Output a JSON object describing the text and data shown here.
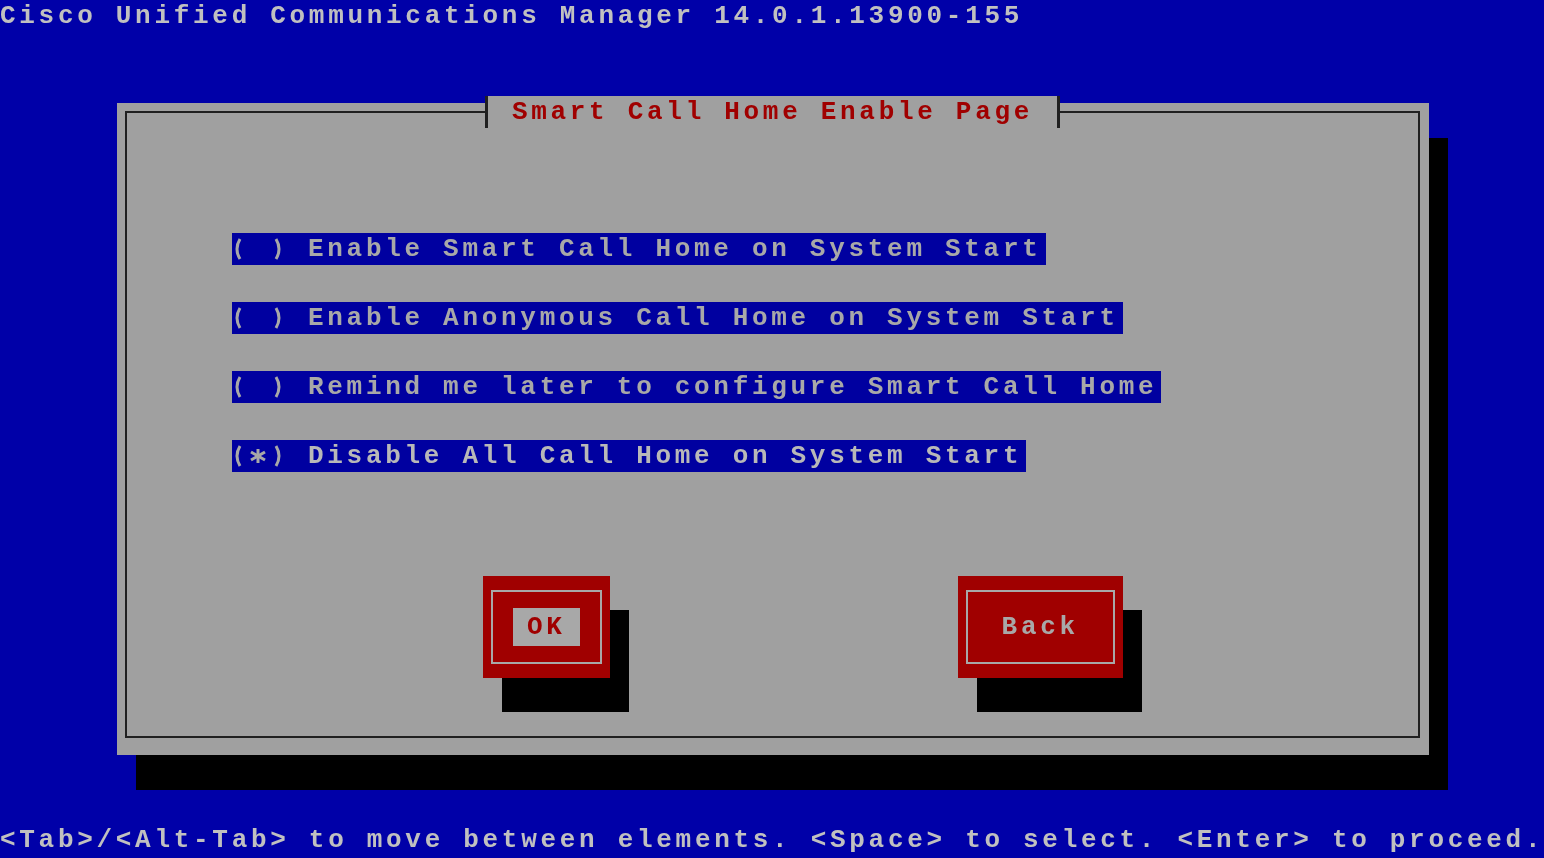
{
  "header": {
    "title": "Cisco Unified Communications Manager 14.0.1.13900-155"
  },
  "dialog": {
    "title": "Smart Call Home Enable Page",
    "options": [
      {
        "label": "Enable Smart Call Home on System Start",
        "selected": false
      },
      {
        "label": "Enable Anonymous Call Home on System Start",
        "selected": false
      },
      {
        "label": "Remind me later to configure Smart Call Home",
        "selected": false
      },
      {
        "label": "Disable All Call Home on System Start",
        "selected": true
      }
    ],
    "buttons": [
      {
        "label": "OK",
        "focused": true
      },
      {
        "label": "Back",
        "focused": false
      }
    ]
  },
  "status_bar": {
    "text": "<Tab>/<Alt-Tab> to move between elements. <Space> to select. <Enter> to proceed."
  }
}
